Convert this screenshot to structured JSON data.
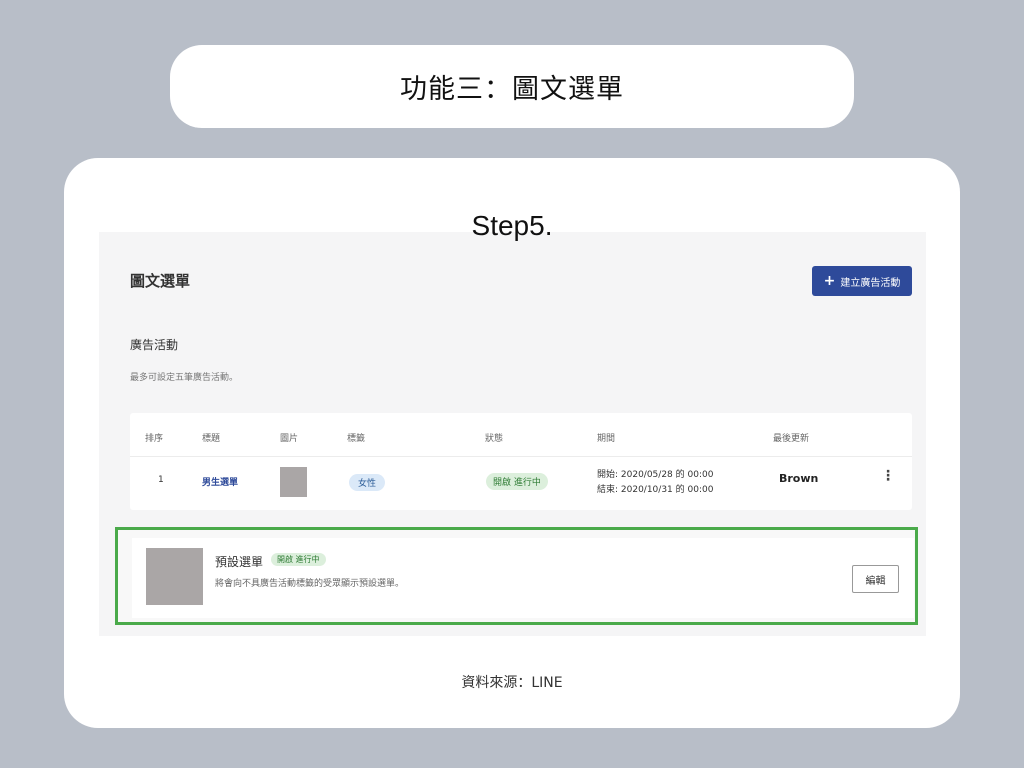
{
  "slide": {
    "title": "功能三：圖文選單",
    "step": "Step5.",
    "source": "資料來源：LINE"
  },
  "app": {
    "page_title": "圖文選單",
    "create_button": "建立廣告活動",
    "section_title": "廣告活動",
    "section_subtitle": "最多可設定五筆廣告活動。",
    "table": {
      "headers": [
        "排序",
        "標題",
        "圖片",
        "標籤",
        "狀態",
        "期間",
        "最後更新"
      ],
      "rows": [
        {
          "order": "1",
          "title": "男生選單",
          "tag": "女性",
          "status": "開啟 進行中",
          "start": "開始:   2020/05/28 的 00:00",
          "end": "結束:   2020/10/31 的 00:00",
          "updated_by": "Brown"
        }
      ]
    },
    "default_menu": {
      "title": "預設選單",
      "status": "開啟 進行中",
      "description": "將會向不具廣告活動標籤的受眾顯示預設選單。",
      "edit_button": "編輯"
    }
  },
  "colors": {
    "background": "#b8bec8",
    "primary_button": "#2e4a9a",
    "highlight_border": "#4aaa4a",
    "status_green": "#dcefdc",
    "tag_blue": "#dbe9f8"
  }
}
